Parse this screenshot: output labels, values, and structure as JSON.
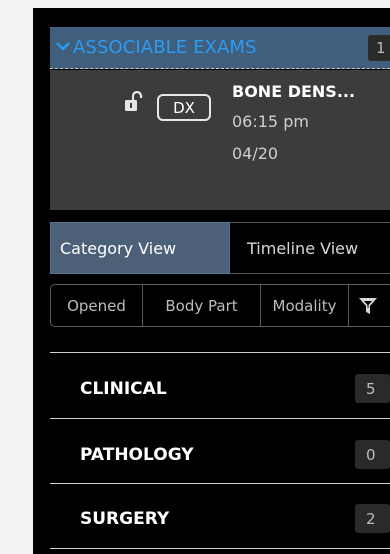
{
  "associable_exams": {
    "title": "ASSOCIABLE EXAMS",
    "count": "1",
    "chevron_icon": "chevron-down-icon",
    "accent_color": "#2d9bf0",
    "header_bg": "#3f5f7c"
  },
  "exam": {
    "lock_icon": "unlocked-padlock-icon",
    "modality": "DX",
    "name": "BONE DENS...",
    "time": "06:15 pm",
    "date": "04/20"
  },
  "view_tabs": {
    "category": "Category View",
    "timeline": "Timeline View",
    "active": "category"
  },
  "filters": {
    "opened": "Opened",
    "body_part": "Body Part",
    "modality": "Modality",
    "filter_icon": "filter-funnel-icon"
  },
  "categories": [
    {
      "label": "CLINICAL",
      "count": "5"
    },
    {
      "label": "PATHOLOGY",
      "count": "0"
    },
    {
      "label": "SURGERY",
      "count": "2"
    }
  ]
}
